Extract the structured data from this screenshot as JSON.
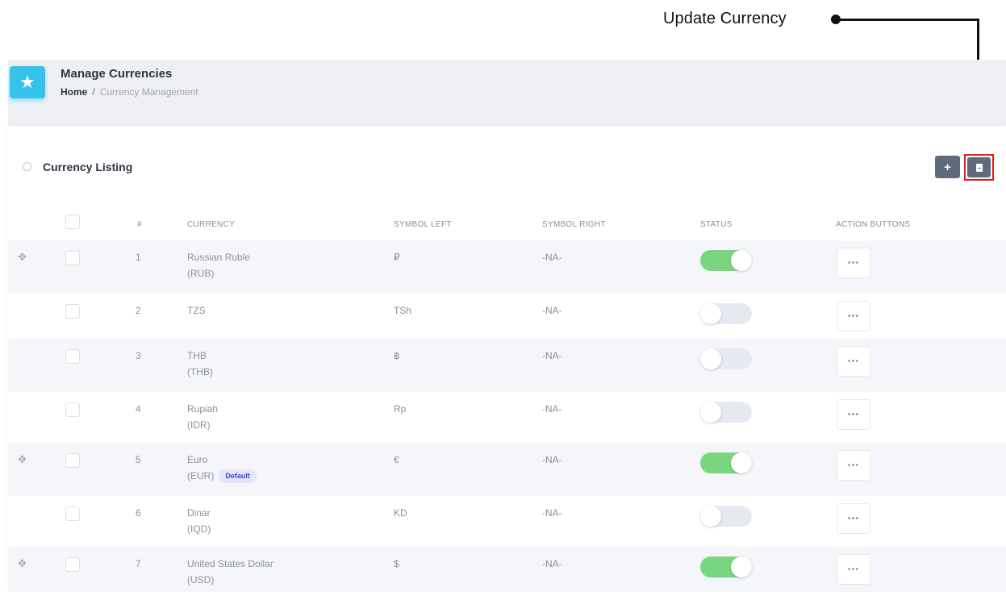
{
  "annotation": {
    "label": "Update Currency"
  },
  "header": {
    "title": "Manage Currencies",
    "breadcrumb": {
      "home": "Home",
      "separator": "/",
      "current": "Currency Management"
    },
    "icon": "star-icon"
  },
  "card": {
    "title": "Currency Listing",
    "add_label": "+",
    "update_icon": "file-icon"
  },
  "table": {
    "columns": [
      "#",
      "CURRENCY",
      "SYMBOL LEFT",
      "SYMBOL RIGHT",
      "STATUS",
      "ACTION BUTTONS"
    ],
    "rows": [
      {
        "num": "1",
        "name": "Russian Ruble",
        "code": "(RUB)",
        "symbol_left": "₽",
        "symbol_right": "-NA-",
        "status": true,
        "draggable": true,
        "badge": "",
        "actions": "•••"
      },
      {
        "num": "2",
        "name": "TZS",
        "code": "",
        "symbol_left": "TSh",
        "symbol_right": "-NA-",
        "status": false,
        "draggable": false,
        "badge": "",
        "actions": "•••"
      },
      {
        "num": "3",
        "name": "THB",
        "code": "(THB)",
        "symbol_left": "฿",
        "symbol_right": "-NA-",
        "status": false,
        "draggable": false,
        "badge": "",
        "actions": "•••"
      },
      {
        "num": "4",
        "name": "Rupiah",
        "code": "(IDR)",
        "symbol_left": "Rp",
        "symbol_right": "-NA-",
        "status": false,
        "draggable": false,
        "badge": "",
        "actions": "•••"
      },
      {
        "num": "5",
        "name": "Euro",
        "code": "(EUR)",
        "symbol_left": "€",
        "symbol_right": "-NA-",
        "status": true,
        "draggable": true,
        "badge": "Default",
        "actions": "•••"
      },
      {
        "num": "6",
        "name": "Dinar",
        "code": "(IQD)",
        "symbol_left": "KD",
        "symbol_right": "-NA-",
        "status": false,
        "draggable": false,
        "badge": "",
        "actions": "•••"
      },
      {
        "num": "7",
        "name": "United States Dollar",
        "code": "(USD)",
        "symbol_left": "$",
        "symbol_right": "-NA-",
        "status": true,
        "draggable": true,
        "badge": "",
        "actions": "•••"
      }
    ]
  },
  "colors": {
    "accent": "#35c3ee",
    "toggle_on": "#79d67f",
    "highlight": "#e31c1c",
    "button": "#5f6b7a",
    "badge_bg": "#e4e5fb",
    "badge_text": "#3b46c9"
  }
}
